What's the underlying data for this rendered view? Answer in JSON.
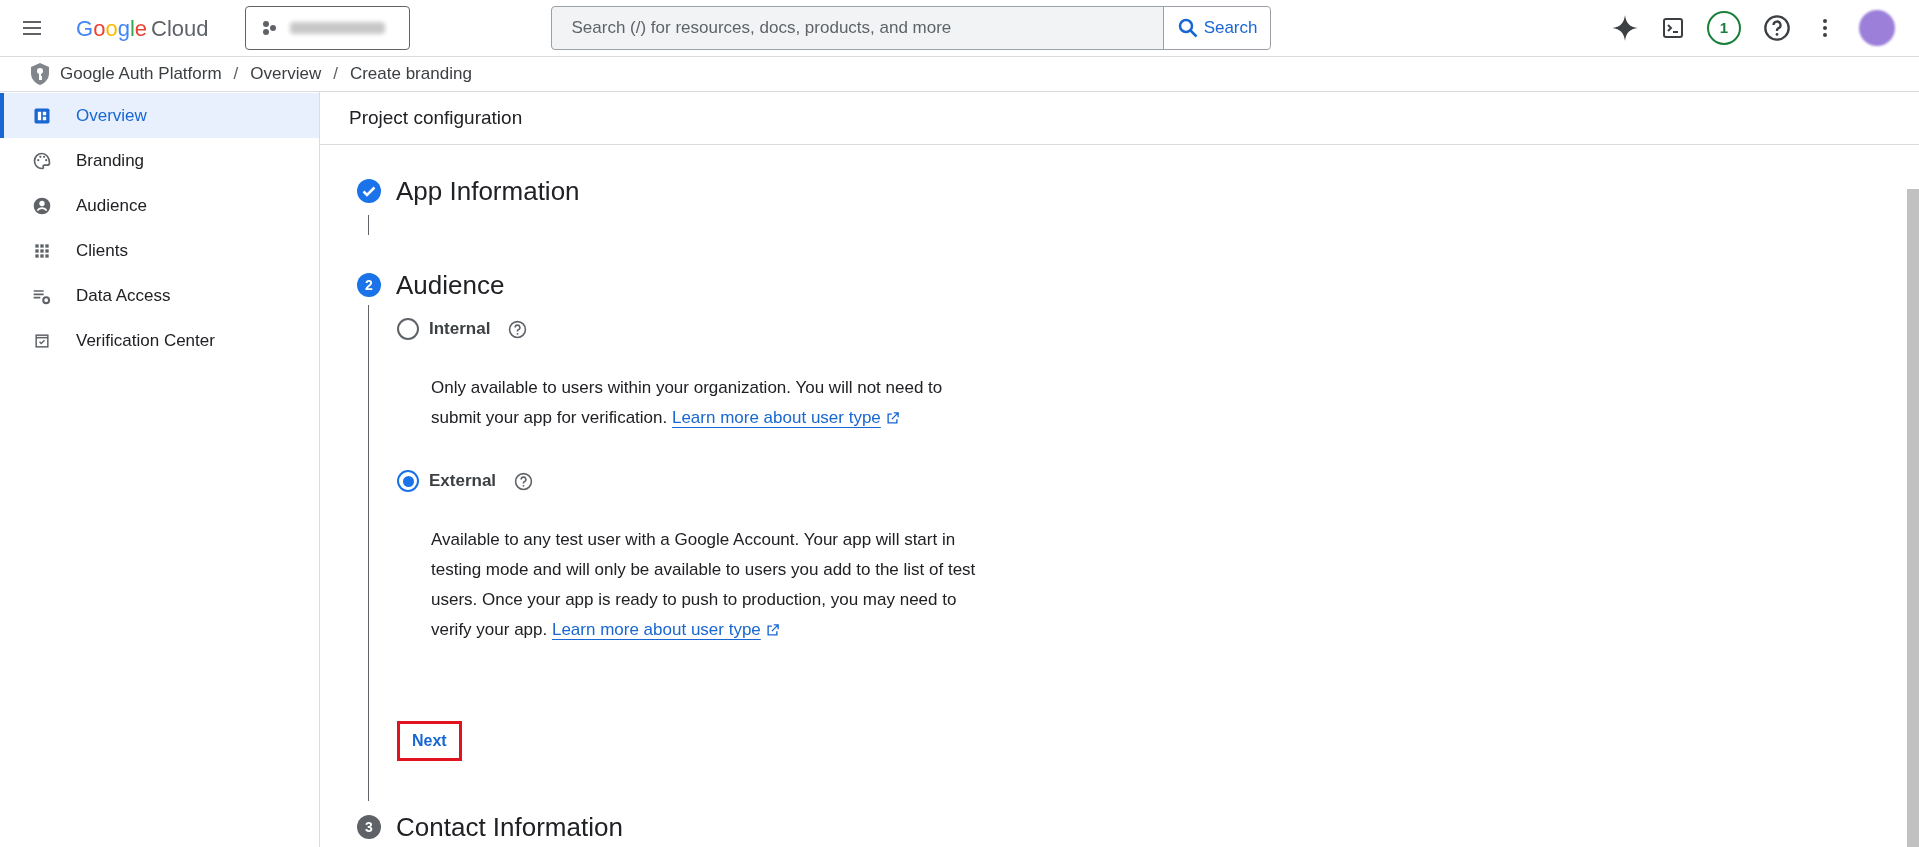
{
  "header": {
    "logo": {
      "first": "Google",
      "second": "Cloud"
    },
    "search": {
      "placeholder": "Search (/) for resources, docs, products, and more",
      "button": "Search"
    },
    "notifications": "1"
  },
  "breadcrumb": [
    {
      "kind": "crumb",
      "text": "Google Auth Platform"
    },
    {
      "kind": "separator",
      "text": "/"
    },
    {
      "kind": "crumb",
      "text": "Overview"
    },
    {
      "kind": "separator",
      "text": "/"
    },
    {
      "kind": "crumb",
      "text": "Create branding"
    }
  ],
  "sidebar": {
    "items": [
      {
        "label": "Overview",
        "selected": true
      },
      {
        "label": "Branding",
        "selected": false
      },
      {
        "label": "Audience",
        "selected": false
      },
      {
        "label": "Clients",
        "selected": false
      },
      {
        "label": "Data Access",
        "selected": false
      },
      {
        "label": "Verification Center",
        "selected": false
      }
    ]
  },
  "page_title": "Project configuration",
  "steps": [
    {
      "kind": "done",
      "title": "App Information"
    },
    {
      "kind": "active",
      "number": "2",
      "title": "Audience",
      "options": [
        {
          "label": "Internal",
          "selected": false,
          "description": "Only available to users within your organization. You will not need to submit your app for verification.",
          "link": "Learn more about user type"
        },
        {
          "label": "External",
          "selected": true,
          "description": "Available to any test user with a Google Account. Your app will start in testing mode and will only be available to users you add to the list of test users. Once your app is ready to push to production, you may need to verify your app.",
          "link": "Learn more about user type"
        }
      ],
      "button": "Next",
      "button_highlighted": true
    },
    {
      "kind": "pending",
      "number": "3",
      "title": "Contact Information"
    }
  ]
}
